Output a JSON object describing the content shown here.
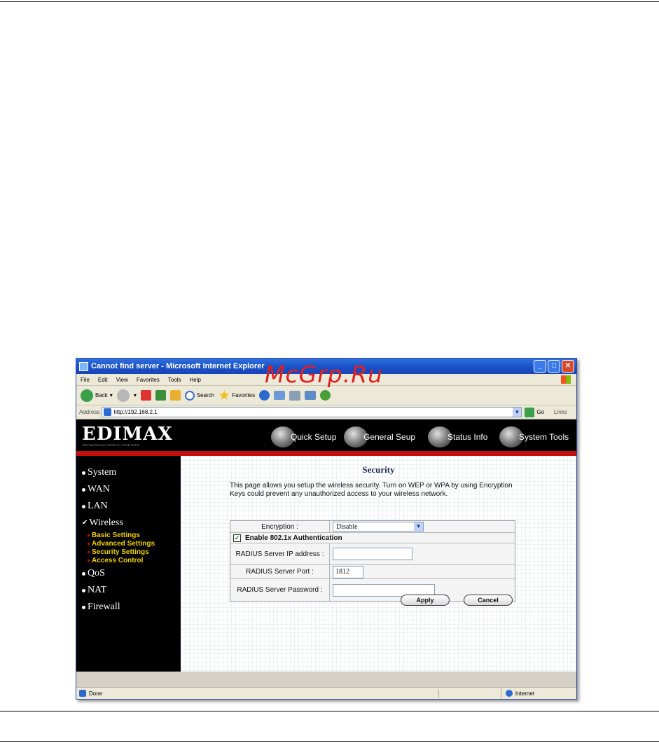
{
  "watermark": "McGrp.Ru",
  "window": {
    "title": "Cannot find server - Microsoft Internet Explorer"
  },
  "menu": [
    "File",
    "Edit",
    "View",
    "Favorites",
    "Tools",
    "Help"
  ],
  "toolbar": {
    "back": "Back",
    "search": "Search",
    "favorites": "Favorites"
  },
  "address": {
    "label": "Address",
    "url": "http://192.168.2.1",
    "go": "Go",
    "links": "Links"
  },
  "banner": {
    "logo": "EDIMAX",
    "tagline": "NETWORKING PEOPLE TOGETHER",
    "nav": [
      "Quick Setup",
      "General Seup",
      "Status Info",
      "System Tools"
    ]
  },
  "sidebar": {
    "items": [
      "System",
      "WAN",
      "LAN",
      "Wireless",
      "QoS",
      "NAT",
      "Firewall"
    ],
    "wireless_sub": [
      "Basic Settings",
      "Advanced Settings",
      "Security Settings",
      "Access Control"
    ]
  },
  "main": {
    "title": "Security",
    "description": "This page allows you setup the wireless security. Turn on WEP or WPA by using Encryption Keys could prevent any unauthorized access to your wireless network.",
    "encryption_label": "Encryption :",
    "encryption_value": "Disable",
    "enable_8021x_label": "Enable 802.1x Authentication",
    "radius_ip_label": "RADIUS Server IP address :",
    "radius_ip_value": "",
    "radius_port_label": "RADIUS Server Port :",
    "radius_port_value": "1812",
    "radius_pw_label": "RADIUS Server Password :",
    "radius_pw_value": "",
    "apply": "Apply",
    "cancel": "Cancel"
  },
  "status": {
    "left": "Done",
    "zone": "Internet"
  }
}
